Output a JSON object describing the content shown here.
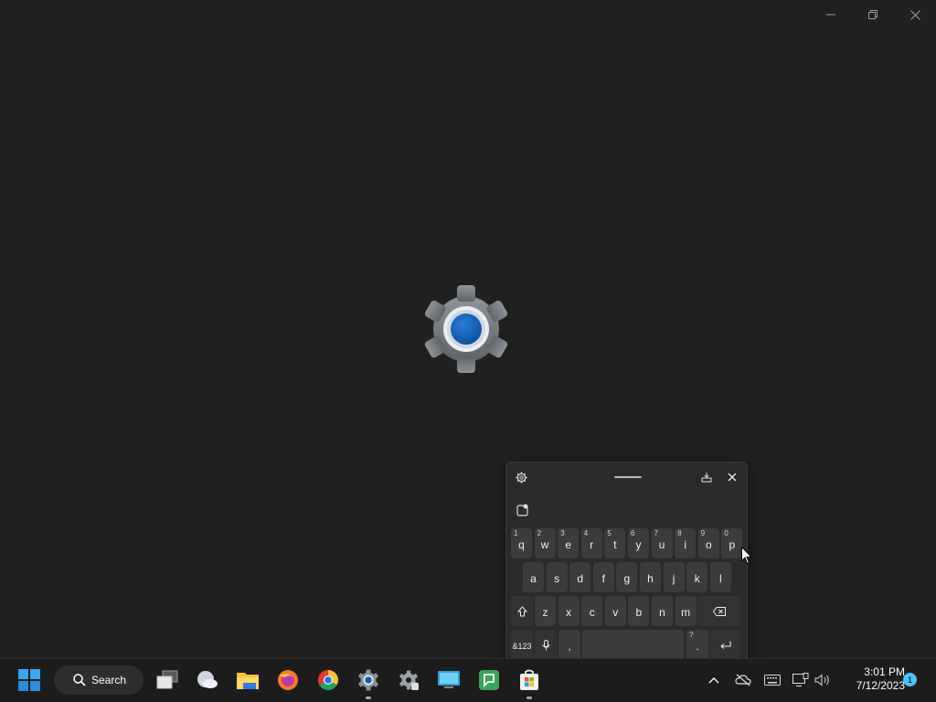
{
  "window": {
    "controls": {
      "minimize": "minimize-icon",
      "restore": "restore-icon",
      "close": "close-icon"
    }
  },
  "splash": {
    "icon": "settings-gear-icon",
    "accent": "#0f5fb8"
  },
  "keyboard": {
    "toolbar": {
      "settings": "gear-icon",
      "handle": "drag-handle",
      "dock": "dock-icon",
      "close": "close-icon"
    },
    "emoji": "emoji-icon",
    "row1": [
      {
        "key": "q",
        "hint": "1"
      },
      {
        "key": "w",
        "hint": "2"
      },
      {
        "key": "e",
        "hint": "3"
      },
      {
        "key": "r",
        "hint": "4"
      },
      {
        "key": "t",
        "hint": "5"
      },
      {
        "key": "y",
        "hint": "6"
      },
      {
        "key": "u",
        "hint": "7"
      },
      {
        "key": "i",
        "hint": "8"
      },
      {
        "key": "o",
        "hint": "9"
      },
      {
        "key": "p",
        "hint": "0"
      }
    ],
    "row2": [
      "a",
      "s",
      "d",
      "f",
      "g",
      "h",
      "j",
      "k",
      "l"
    ],
    "row3": [
      "z",
      "x",
      "c",
      "v",
      "b",
      "n",
      "m"
    ],
    "row4": {
      "symbols": "&123",
      "comma": ",",
      "period": ".",
      "period_hint": "?"
    }
  },
  "taskbar": {
    "search_label": "Search",
    "apps": [
      "start-icon",
      "task-view-icon",
      "weather-icon",
      "file-explorer-icon",
      "firefox-icon",
      "chrome-icon",
      "settings-icon",
      "settings-alt-icon",
      "remote-desktop-icon",
      "chat-icon",
      "microsoft-store-icon"
    ],
    "tray": [
      "chevron-up-icon",
      "onedrive-icon",
      "keyboard-icon",
      "network-icon",
      "volume-icon"
    ],
    "time": "3:01 PM",
    "date": "7/12/2023",
    "notification_count": "1"
  }
}
